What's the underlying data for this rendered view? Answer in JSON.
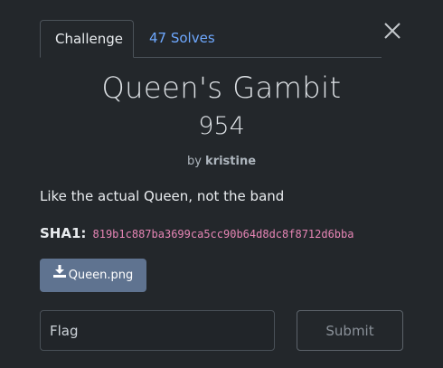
{
  "tabs": {
    "challenge_label": "Challenge",
    "solves_label": "47 Solves"
  },
  "challenge": {
    "name": "Queen's Gambit",
    "points": "954",
    "author_prefix": "by",
    "author": "kristine",
    "description": "Like the actual Queen, not the band",
    "hash_label": "SHA1:",
    "hash_value": "819b1c887ba3699ca5cc90b64d8dc8f8712d6bba"
  },
  "file": {
    "label": "Queen.png",
    "icon": "download-icon"
  },
  "form": {
    "flag_placeholder": "Flag",
    "submit_label": "Submit"
  },
  "colors": {
    "background": "#23272b",
    "link": "#6ea8fe",
    "hash": "#e685b5",
    "file_button": "#5f7390"
  }
}
